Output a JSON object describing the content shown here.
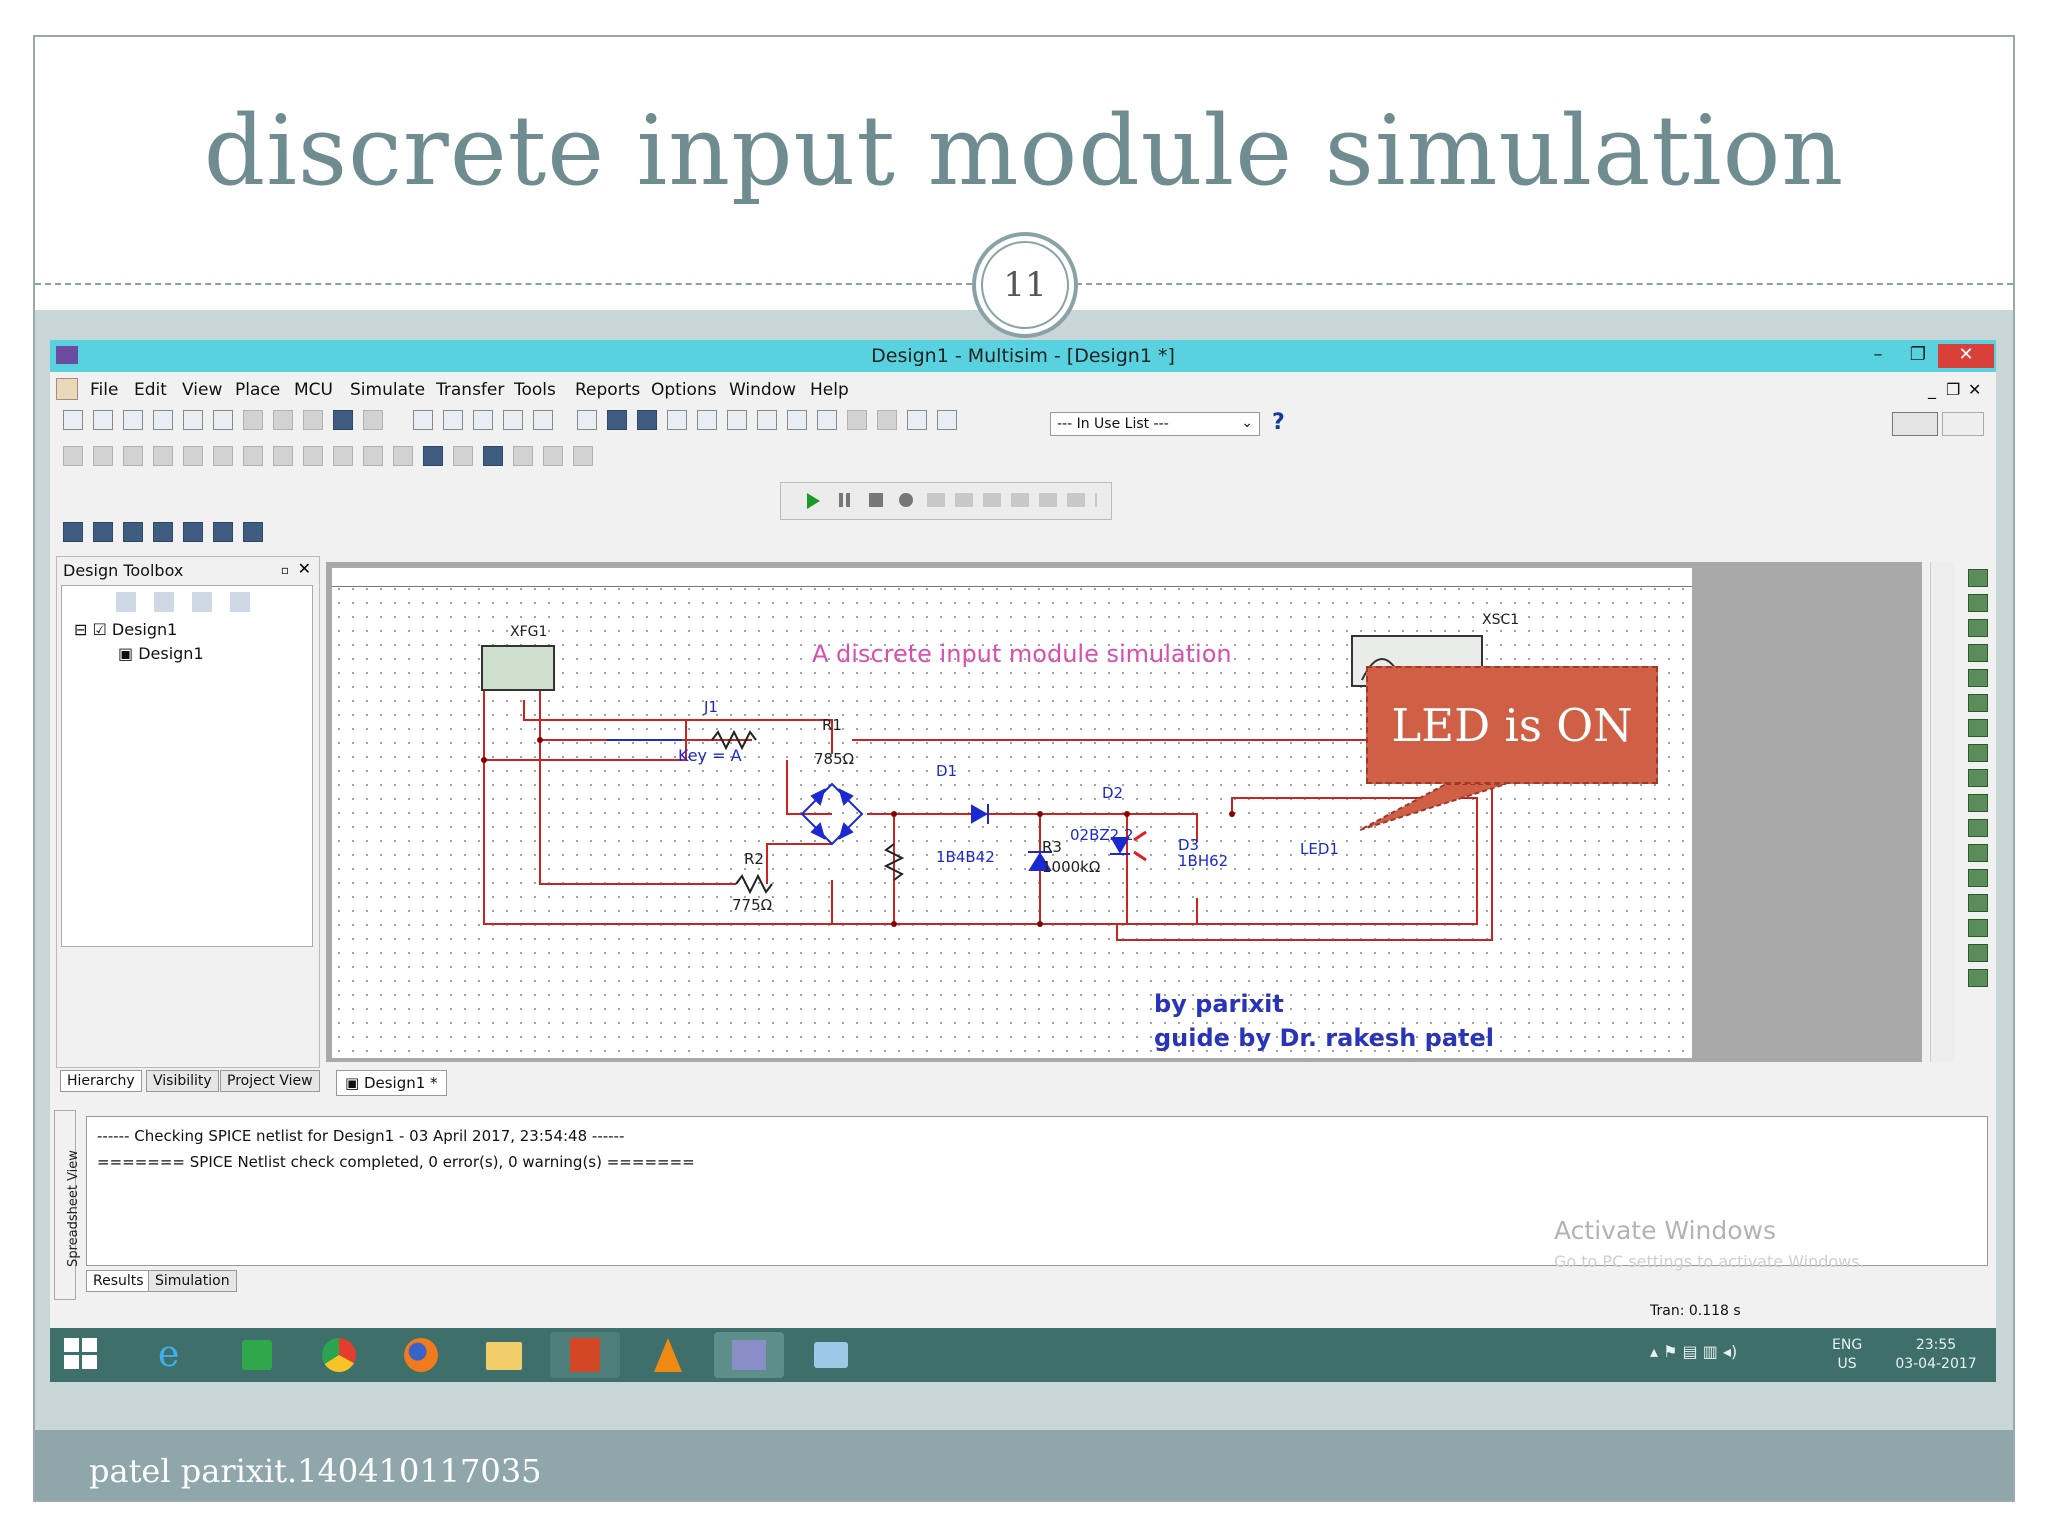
{
  "slide": {
    "title": "discrete input module simulation",
    "page_number": "11",
    "footer": "patel parixit.140410117035"
  },
  "window": {
    "title": "Design1 - Multisim - [Design1 *]",
    "minimize": "–",
    "restore": "❐",
    "close": "✕"
  },
  "menu": [
    "File",
    "Edit",
    "View",
    "Place",
    "MCU",
    "Simulate",
    "Transfer",
    "Tools",
    "Reports",
    "Options",
    "Window",
    "Help"
  ],
  "toolbar": {
    "in_use_list": "--- In Use List ---",
    "help": "?"
  },
  "design_toolbox": {
    "title": "Design Toolbox",
    "tree": [
      "Design1",
      "Design1"
    ],
    "tabs": [
      "Hierarchy",
      "Visibility",
      "Project View"
    ]
  },
  "document_tab": "Design1 *",
  "schematic": {
    "heading": "A discrete input module simulation",
    "credit_line1": "by parixit",
    "credit_line2": "guide by Dr. rakesh patel",
    "components": {
      "xfg": "XFG1",
      "xsc": "XSC1",
      "j1": "J1",
      "key": "Key = A",
      "r1": "R1",
      "r1_val": "785Ω",
      "d1": "D1",
      "d1_val": "1B4B42",
      "d2": "D2",
      "d2_val": "02BZ2.2",
      "r2": "R2",
      "r2_val": "775Ω",
      "r3": "R3",
      "r3_val": "1000kΩ",
      "d3": "D3",
      "d3_val": "1BH62",
      "led": "LED1"
    },
    "callout": "LED is ON"
  },
  "spreadsheet": {
    "side_label": "Spreadsheet View",
    "log_line1": "------ Checking SPICE netlist for Design1 - 03 April 2017, 23:54:48 ------",
    "log_line2": "======= SPICE Netlist check completed, 0 error(s), 0 warning(s) =======",
    "tabs": [
      "Results",
      "Simulation"
    ]
  },
  "watermark": {
    "line1": "Activate Windows",
    "line2": "Go to PC settings to activate Windows."
  },
  "status": "Tran: 0.118 s",
  "taskbar": {
    "lang1": "ENG",
    "lang2": "US",
    "time": "23:55",
    "date": "03-04-2017"
  },
  "colors": {
    "title_text": "#6f8d91",
    "callout_bg": "#cf6045",
    "titlebar": "#58d2df",
    "taskbar": "#3f6f6a",
    "heading_pink": "#d94fb0",
    "credit_blue": "#2a34b8",
    "wire_red": "#cc2222",
    "component_blue": "#1a2ad0"
  }
}
